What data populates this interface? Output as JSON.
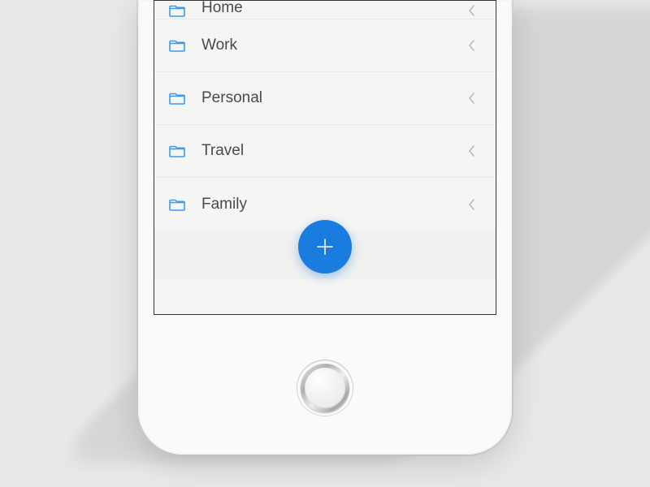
{
  "list": {
    "items": [
      {
        "label": "Home"
      },
      {
        "label": "Work"
      },
      {
        "label": "Personal"
      },
      {
        "label": "Travel"
      },
      {
        "label": "Family"
      }
    ]
  },
  "colors": {
    "accent": "#1b7ce0",
    "icon": "#3b9aec",
    "text": "#4a4a4a",
    "chevron": "#b8b8b8"
  },
  "fab": {
    "icon_name": "plus-icon"
  }
}
